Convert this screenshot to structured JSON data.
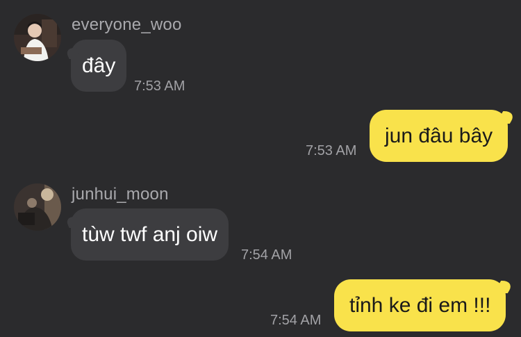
{
  "messages": [
    {
      "sender": "everyone_woo",
      "text": "đây",
      "time": "7:53 AM",
      "direction": "incoming",
      "avatar": "avatar-photo"
    },
    {
      "text": "jun đâu bây",
      "time": "7:53 AM",
      "direction": "outgoing"
    },
    {
      "sender": "junhui_moon",
      "text": "tùw twf anj oiw",
      "time": "7:54 AM",
      "direction": "incoming",
      "avatar": "avatar-photo"
    },
    {
      "text": "tỉnh ke đi em !!!",
      "time": "7:54 AM",
      "direction": "outgoing"
    }
  ],
  "colors": {
    "background": "#2b2b2d",
    "incoming_bubble": "#3d3d40",
    "outgoing_bubble": "#f9e24b",
    "meta_text": "#a9a9ad"
  }
}
